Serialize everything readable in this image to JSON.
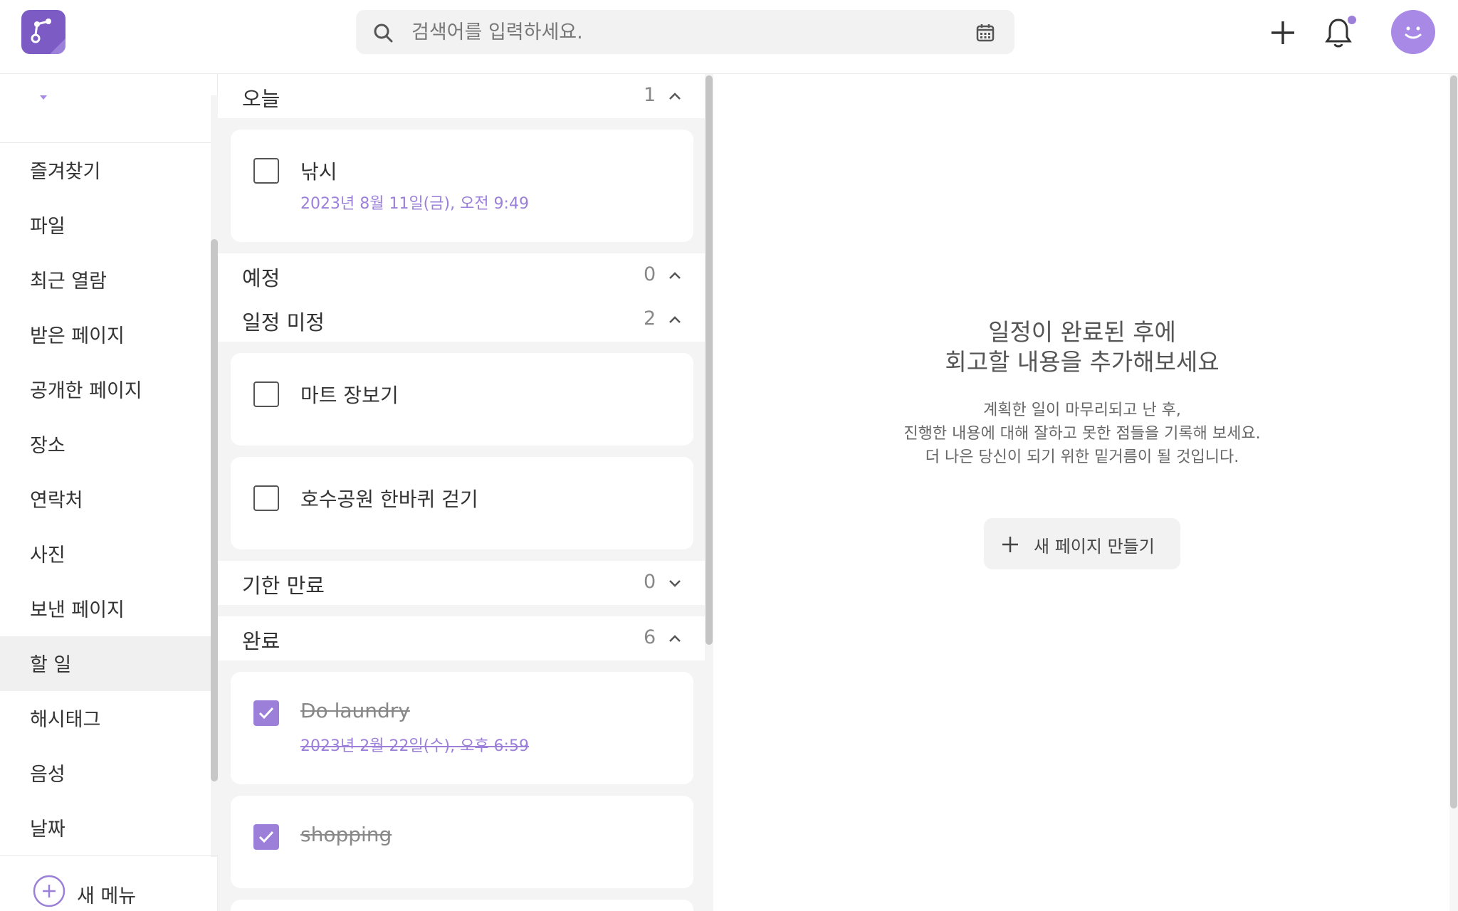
{
  "header": {
    "search_placeholder": "검색어를 입력하세요.",
    "icons": {
      "logo": "app-logo",
      "search": "search-icon",
      "calendar": "calendar-icon",
      "add": "plus-icon",
      "notifications": "bell-icon",
      "avatar": "smiley-avatar"
    },
    "notification_badge": true
  },
  "sidebar": {
    "items": [
      {
        "label": "즐겨찾기"
      },
      {
        "label": "파일"
      },
      {
        "label": "최근 열람"
      },
      {
        "label": "받은 페이지"
      },
      {
        "label": "공개한 페이지"
      },
      {
        "label": "장소"
      },
      {
        "label": "연락처"
      },
      {
        "label": "사진"
      },
      {
        "label": "보낸 페이지"
      },
      {
        "label": "할 일",
        "active": true
      },
      {
        "label": "해시태그"
      },
      {
        "label": "음성"
      },
      {
        "label": "날짜"
      }
    ],
    "new_menu_label": "새 메뉴"
  },
  "tasks": {
    "sections": [
      {
        "title": "오늘",
        "count": "1",
        "expanded": true,
        "items": [
          {
            "title": "낚시",
            "date": "2023년 8월 11일(금), 오전 9:49",
            "done": false
          }
        ]
      },
      {
        "title": "예정",
        "count": "0",
        "expanded": true,
        "items": []
      },
      {
        "title": "일정 미정",
        "count": "2",
        "expanded": true,
        "items": [
          {
            "title": "마트 장보기",
            "done": false
          },
          {
            "title": "호수공원 한바퀴 걷기",
            "done": false
          }
        ]
      },
      {
        "title": "기한 만료",
        "count": "0",
        "expanded": false,
        "items": []
      },
      {
        "title": "완료",
        "count": "6",
        "expanded": true,
        "items": [
          {
            "title": "Do laundry",
            "date": "2023년 2월 22일(수), 오후 6:59",
            "done": true
          },
          {
            "title": "shopping",
            "done": true
          }
        ]
      }
    ]
  },
  "detail": {
    "heading_line1": "일정이 완료된 후에",
    "heading_line2": "회고할 내용을 추가해보세요",
    "sub_line1": "계획한 일이 마무리되고 난 후,",
    "sub_line2": "진행한 내용에 대해 잘하고 못한 점들을 기록해 보세요.",
    "sub_line3": "더 나은 당신이 되기 위한 밑거름이 될 것입니다.",
    "new_page_label": "새 페이지 만들기"
  },
  "colors": {
    "accent": "#9b7fd8",
    "logo": "#7c5cc4",
    "avatar": "#a88ae6"
  }
}
